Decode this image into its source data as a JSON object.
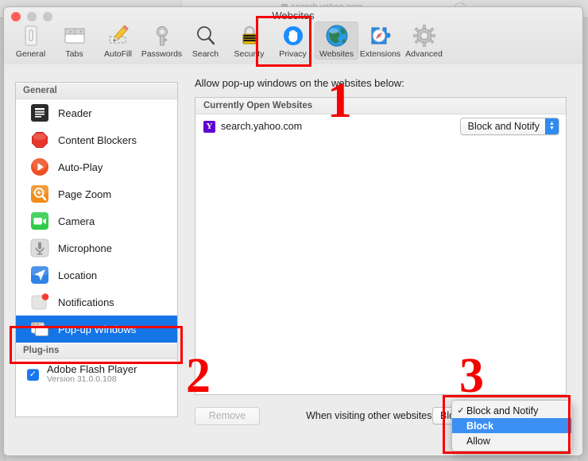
{
  "background_browser": {
    "tab_title": "search.yahoo.com",
    "close_glyph": "○"
  },
  "window": {
    "title": "Websites"
  },
  "toolbar": {
    "items": [
      {
        "label": "General",
        "icon": "general-icon",
        "selected": false
      },
      {
        "label": "Tabs",
        "icon": "tabs-icon",
        "selected": false
      },
      {
        "label": "AutoFill",
        "icon": "autofill-icon",
        "selected": false
      },
      {
        "label": "Passwords",
        "icon": "passwords-icon",
        "selected": false
      },
      {
        "label": "Search",
        "icon": "search-icon",
        "selected": false
      },
      {
        "label": "Security",
        "icon": "security-icon",
        "selected": false
      },
      {
        "label": "Privacy",
        "icon": "privacy-icon",
        "selected": false
      },
      {
        "label": "Websites",
        "icon": "websites-icon",
        "selected": true
      },
      {
        "label": "Extensions",
        "icon": "extensions-icon",
        "selected": false
      },
      {
        "label": "Advanced",
        "icon": "advanced-icon",
        "selected": false
      }
    ]
  },
  "sidebar": {
    "group_general": "General",
    "group_plugins": "Plug-ins",
    "items": [
      {
        "label": "Reader",
        "icon": "reader-icon",
        "selected": false
      },
      {
        "label": "Content Blockers",
        "icon": "content-blockers-icon",
        "selected": false
      },
      {
        "label": "Auto-Play",
        "icon": "auto-play-icon",
        "selected": false
      },
      {
        "label": "Page Zoom",
        "icon": "page-zoom-icon",
        "selected": false
      },
      {
        "label": "Camera",
        "icon": "camera-icon",
        "selected": false
      },
      {
        "label": "Microphone",
        "icon": "microphone-icon",
        "selected": false
      },
      {
        "label": "Location",
        "icon": "location-icon",
        "selected": false
      },
      {
        "label": "Notifications",
        "icon": "notifications-icon",
        "selected": false
      },
      {
        "label": "Pop-up Windows",
        "icon": "popup-windows-icon",
        "selected": true
      }
    ],
    "plugins": [
      {
        "name": "Adobe Flash Player",
        "version": "Version 31.0.0.108",
        "checked": true,
        "check_glyph": "✓"
      }
    ]
  },
  "pane": {
    "description": "Allow pop-up windows on the websites below:",
    "list_header": "Currently Open Websites",
    "rows": [
      {
        "site": "search.yahoo.com",
        "favicon_letter": "Y",
        "setting": "Block and Notify"
      }
    ],
    "remove_label": "Remove",
    "when_visiting_label": "When visiting other websites:",
    "default_setting": "Block and Notify",
    "stepper_up": "▲",
    "stepper_down": "▼",
    "help_label": "?"
  },
  "dropdown_menu": {
    "open": true,
    "items": [
      {
        "label": "Block and Notify",
        "checked": true,
        "highlighted": false,
        "check_glyph": "✓"
      },
      {
        "label": "Block",
        "checked": false,
        "highlighted": true,
        "check_glyph": ""
      },
      {
        "label": "Allow",
        "checked": false,
        "highlighted": false,
        "check_glyph": ""
      }
    ]
  },
  "annotations": {
    "color": "#f60000",
    "markers": [
      {
        "number": "1",
        "target": "websites-toolbar-tab"
      },
      {
        "number": "2",
        "target": "popup-windows-sidebar-item"
      },
      {
        "number": "3",
        "target": "default-setting-dropdown-menu"
      }
    ]
  }
}
